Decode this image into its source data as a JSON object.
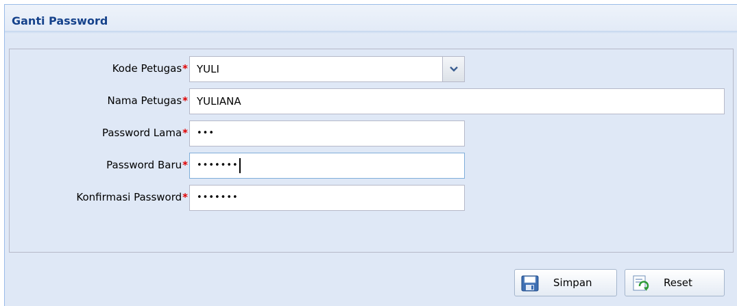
{
  "panel": {
    "title": "Ganti Password"
  },
  "form": {
    "kode_petugas": {
      "label": "Kode Petugas",
      "value": "YULI"
    },
    "nama_petugas": {
      "label": "Nama Petugas",
      "value": "YULIANA"
    },
    "password_lama": {
      "label": "Password Lama",
      "value": "•••"
    },
    "password_baru": {
      "label": "Password Baru",
      "value": "•••••••"
    },
    "konfirmasi_password": {
      "label": "Konfirmasi Password",
      "value": "•••••••"
    },
    "required_marker": "*"
  },
  "buttons": {
    "simpan": "Simpan",
    "reset": "Reset"
  },
  "icons": {
    "save": "floppy-disk-icon",
    "reset": "reset-form-icon",
    "combo": "chevron-down-icon"
  },
  "colors": {
    "header_text": "#15428b",
    "panel_bg": "#dfe8f6",
    "required": "#e00000",
    "border": "#99bbe8"
  }
}
